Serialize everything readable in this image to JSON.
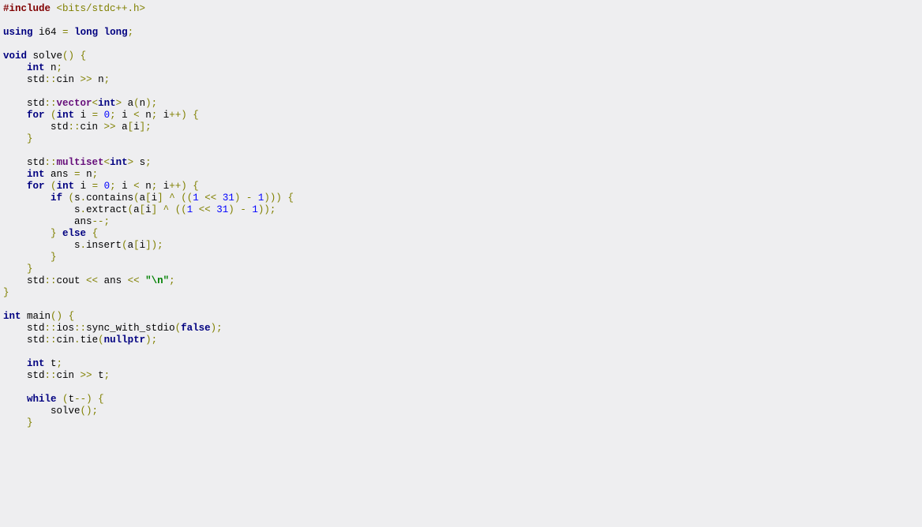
{
  "code": {
    "tokens": [
      [
        [
          "pp",
          "#include"
        ],
        [
          "",
          " "
        ],
        [
          "pstr",
          "<bits/stdc++.h>"
        ]
      ],
      [],
      [
        [
          "kw",
          "using"
        ],
        [
          "",
          " i64 "
        ],
        [
          "par",
          "="
        ],
        [
          "",
          " "
        ],
        [
          "kw",
          "long long"
        ],
        [
          "par",
          ";"
        ]
      ],
      [],
      [
        [
          "kw",
          "void"
        ],
        [
          "",
          " solve"
        ],
        [
          "par",
          "()"
        ],
        [
          "",
          " "
        ],
        [
          "par",
          "{"
        ]
      ],
      [
        [
          "",
          "    "
        ],
        [
          "kw",
          "int"
        ],
        [
          "",
          " n"
        ],
        [
          "par",
          ";"
        ]
      ],
      [
        [
          "",
          "    std"
        ],
        [
          "par",
          "::"
        ],
        [
          "",
          "cin "
        ],
        [
          "par",
          ">>"
        ],
        [
          "",
          " n"
        ],
        [
          "par",
          ";"
        ]
      ],
      [
        [
          "",
          "    "
        ]
      ],
      [
        [
          "",
          "    std"
        ],
        [
          "par",
          "::"
        ],
        [
          "typ",
          "vector"
        ],
        [
          "par",
          "<"
        ],
        [
          "kw",
          "int"
        ],
        [
          "par",
          ">"
        ],
        [
          "",
          " a"
        ],
        [
          "par",
          "("
        ],
        [
          "",
          "n"
        ],
        [
          "par",
          ");"
        ]
      ],
      [
        [
          "",
          "    "
        ],
        [
          "kw",
          "for"
        ],
        [
          "",
          " "
        ],
        [
          "par",
          "("
        ],
        [
          "kw",
          "int"
        ],
        [
          "",
          " i "
        ],
        [
          "par",
          "="
        ],
        [
          "",
          " "
        ],
        [
          "num",
          "0"
        ],
        [
          "par",
          ";"
        ],
        [
          "",
          " i "
        ],
        [
          "par",
          "<"
        ],
        [
          "",
          " n"
        ],
        [
          "par",
          ";"
        ],
        [
          "",
          " i"
        ],
        [
          "par",
          "++)"
        ],
        [
          "",
          " "
        ],
        [
          "par",
          "{"
        ]
      ],
      [
        [
          "",
          "        std"
        ],
        [
          "par",
          "::"
        ],
        [
          "",
          "cin "
        ],
        [
          "par",
          ">>"
        ],
        [
          "",
          " a"
        ],
        [
          "par",
          "["
        ],
        [
          "",
          "i"
        ],
        [
          "par",
          "];"
        ]
      ],
      [
        [
          "",
          "    "
        ],
        [
          "par",
          "}"
        ]
      ],
      [
        [
          "",
          "    "
        ]
      ],
      [
        [
          "",
          "    std"
        ],
        [
          "par",
          "::"
        ],
        [
          "typ",
          "multiset"
        ],
        [
          "par",
          "<"
        ],
        [
          "kw",
          "int"
        ],
        [
          "par",
          ">"
        ],
        [
          "",
          " s"
        ],
        [
          "par",
          ";"
        ]
      ],
      [
        [
          "",
          "    "
        ],
        [
          "kw",
          "int"
        ],
        [
          "",
          " ans "
        ],
        [
          "par",
          "="
        ],
        [
          "",
          " n"
        ],
        [
          "par",
          ";"
        ]
      ],
      [
        [
          "",
          "    "
        ],
        [
          "kw",
          "for"
        ],
        [
          "",
          " "
        ],
        [
          "par",
          "("
        ],
        [
          "kw",
          "int"
        ],
        [
          "",
          " i "
        ],
        [
          "par",
          "="
        ],
        [
          "",
          " "
        ],
        [
          "num",
          "0"
        ],
        [
          "par",
          ";"
        ],
        [
          "",
          " i "
        ],
        [
          "par",
          "<"
        ],
        [
          "",
          " n"
        ],
        [
          "par",
          ";"
        ],
        [
          "",
          " i"
        ],
        [
          "par",
          "++)"
        ],
        [
          "",
          " "
        ],
        [
          "par",
          "{"
        ]
      ],
      [
        [
          "",
          "        "
        ],
        [
          "kw",
          "if"
        ],
        [
          "",
          " "
        ],
        [
          "par",
          "("
        ],
        [
          "",
          "s"
        ],
        [
          "par",
          "."
        ],
        [
          "",
          "contains"
        ],
        [
          "par",
          "("
        ],
        [
          "",
          "a"
        ],
        [
          "par",
          "["
        ],
        [
          "",
          "i"
        ],
        [
          "par",
          "]"
        ],
        [
          "",
          " "
        ],
        [
          "par",
          "^"
        ],
        [
          "",
          " "
        ],
        [
          "par",
          "(("
        ],
        [
          "num",
          "1"
        ],
        [
          "",
          " "
        ],
        [
          "par",
          "<<"
        ],
        [
          "",
          " "
        ],
        [
          "num",
          "31"
        ],
        [
          "par",
          ")"
        ],
        [
          "",
          " "
        ],
        [
          "par",
          "-"
        ],
        [
          "",
          " "
        ],
        [
          "num",
          "1"
        ],
        [
          "par",
          ")))"
        ],
        [
          "",
          " "
        ],
        [
          "par",
          "{"
        ]
      ],
      [
        [
          "",
          "            s"
        ],
        [
          "par",
          "."
        ],
        [
          "",
          "extract"
        ],
        [
          "par",
          "("
        ],
        [
          "",
          "a"
        ],
        [
          "par",
          "["
        ],
        [
          "",
          "i"
        ],
        [
          "par",
          "]"
        ],
        [
          "",
          " "
        ],
        [
          "par",
          "^"
        ],
        [
          "",
          " "
        ],
        [
          "par",
          "(("
        ],
        [
          "num",
          "1"
        ],
        [
          "",
          " "
        ],
        [
          "par",
          "<<"
        ],
        [
          "",
          " "
        ],
        [
          "num",
          "31"
        ],
        [
          "par",
          ")"
        ],
        [
          "",
          " "
        ],
        [
          "par",
          "-"
        ],
        [
          "",
          " "
        ],
        [
          "num",
          "1"
        ],
        [
          "par",
          "));"
        ]
      ],
      [
        [
          "",
          "            ans"
        ],
        [
          "par",
          "--;"
        ]
      ],
      [
        [
          "",
          "        "
        ],
        [
          "par",
          "}"
        ],
        [
          "",
          " "
        ],
        [
          "kw",
          "else"
        ],
        [
          "",
          " "
        ],
        [
          "par",
          "{"
        ]
      ],
      [
        [
          "",
          "            s"
        ],
        [
          "par",
          "."
        ],
        [
          "",
          "insert"
        ],
        [
          "par",
          "("
        ],
        [
          "",
          "a"
        ],
        [
          "par",
          "["
        ],
        [
          "",
          "i"
        ],
        [
          "par",
          "]);"
        ]
      ],
      [
        [
          "",
          "        "
        ],
        [
          "par",
          "}"
        ]
      ],
      [
        [
          "",
          "    "
        ],
        [
          "par",
          "}"
        ]
      ],
      [
        [
          "",
          "    std"
        ],
        [
          "par",
          "::"
        ],
        [
          "",
          "cout "
        ],
        [
          "par",
          "<<"
        ],
        [
          "",
          " ans "
        ],
        [
          "par",
          "<<"
        ],
        [
          "",
          " "
        ],
        [
          "str",
          "\"\\n\""
        ],
        [
          "par",
          ";"
        ]
      ],
      [
        [
          "par",
          "}"
        ]
      ],
      [],
      [
        [
          "kw",
          "int"
        ],
        [
          "",
          " main"
        ],
        [
          "par",
          "()"
        ],
        [
          "",
          " "
        ],
        [
          "par",
          "{"
        ]
      ],
      [
        [
          "",
          "    std"
        ],
        [
          "par",
          "::"
        ],
        [
          "",
          "ios"
        ],
        [
          "par",
          "::"
        ],
        [
          "",
          "sync_with_stdio"
        ],
        [
          "par",
          "("
        ],
        [
          "kw",
          "false"
        ],
        [
          "par",
          ");"
        ]
      ],
      [
        [
          "",
          "    std"
        ],
        [
          "par",
          "::"
        ],
        [
          "",
          "cin"
        ],
        [
          "par",
          "."
        ],
        [
          "",
          "tie"
        ],
        [
          "par",
          "("
        ],
        [
          "kw",
          "nullptr"
        ],
        [
          "par",
          ");"
        ]
      ],
      [
        [
          "",
          "    "
        ]
      ],
      [
        [
          "",
          "    "
        ],
        [
          "kw",
          "int"
        ],
        [
          "",
          " t"
        ],
        [
          "par",
          ";"
        ]
      ],
      [
        [
          "",
          "    std"
        ],
        [
          "par",
          "::"
        ],
        [
          "",
          "cin "
        ],
        [
          "par",
          ">>"
        ],
        [
          "",
          " t"
        ],
        [
          "par",
          ";"
        ]
      ],
      [
        [
          "",
          "    "
        ]
      ],
      [
        [
          "",
          "    "
        ],
        [
          "kw",
          "while"
        ],
        [
          "",
          " "
        ],
        [
          "par",
          "("
        ],
        [
          "",
          "t"
        ],
        [
          "par",
          "--)"
        ],
        [
          "",
          " "
        ],
        [
          "par",
          "{"
        ]
      ],
      [
        [
          "",
          "        solve"
        ],
        [
          "par",
          "();"
        ]
      ],
      [
        [
          "",
          "    "
        ],
        [
          "par",
          "}"
        ]
      ]
    ]
  }
}
